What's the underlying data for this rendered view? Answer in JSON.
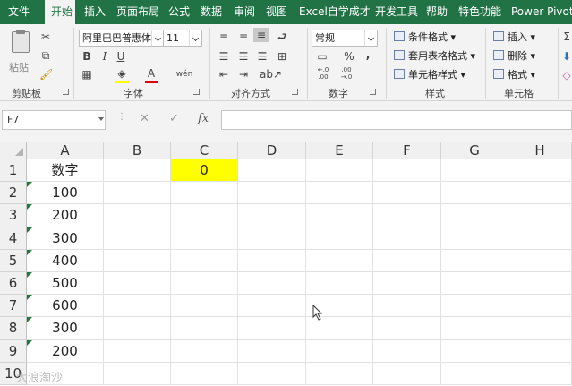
{
  "tabs": [
    "文件",
    "开始",
    "插入",
    "页面布局",
    "公式",
    "数据",
    "审阅",
    "视图",
    "Excel自学成才",
    "开发工具",
    "帮助",
    "特色功能",
    "Power Pivot"
  ],
  "active_tab": "开始",
  "clipboard": {
    "paste_label": "粘贴",
    "group_label": "剪贴板"
  },
  "font": {
    "name": "阿里巴巴普惠体",
    "size": "11",
    "group_label": "字体",
    "bold": "B",
    "italic": "I",
    "underline": "U",
    "font_color_glyph": "A",
    "wen": "wén"
  },
  "alignment": {
    "group_label": "对齐方式"
  },
  "number": {
    "format": "常规",
    "group_label": "数字",
    "percent": "%",
    "comma": ",",
    "inc_decimal": "←.0\n.00",
    "dec_decimal": ".00\n→.0"
  },
  "styles": {
    "conditional_format": "条件格式",
    "table_format": "套用表格格式",
    "cell_style": "单元格样式",
    "group_label": "样式"
  },
  "cells_group": {
    "insert": "插入",
    "delete": "删除",
    "format": "格式",
    "group_label": "单元格"
  },
  "formula_bar": {
    "name_box": "F7",
    "cancel": "✕",
    "enter": "✓",
    "fx": "fx",
    "formula": ""
  },
  "sheet": {
    "columns": [
      "A",
      "B",
      "C",
      "D",
      "E",
      "F",
      "G",
      "H"
    ],
    "rows": [
      {
        "num": "1",
        "a": "数字",
        "c": "0"
      },
      {
        "num": "2",
        "a": "100"
      },
      {
        "num": "3",
        "a": "200"
      },
      {
        "num": "4",
        "a": "300"
      },
      {
        "num": "5",
        "a": "400"
      },
      {
        "num": "6",
        "a": "500"
      },
      {
        "num": "7",
        "a": "600"
      },
      {
        "num": "8",
        "a": "300"
      },
      {
        "num": "9",
        "a": "200"
      },
      {
        "num": "10",
        "a": ""
      }
    ],
    "highlight_color": "#ffff00"
  },
  "watermark": "大浪淘沙",
  "colors": {
    "brand": "#217346",
    "flag": "#1d7a38"
  }
}
